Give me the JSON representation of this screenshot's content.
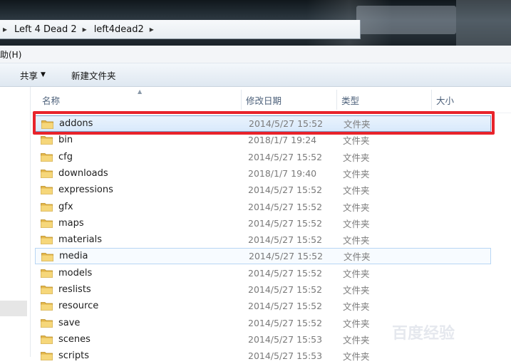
{
  "address": {
    "crumbs": [
      "Left 4 Dead 2",
      "left4dead2"
    ]
  },
  "menubar": {
    "help_label": "帮助(H)"
  },
  "toolbar": {
    "share_label": "共享",
    "new_folder_label": "新建文件夹"
  },
  "columns": {
    "name": "名称",
    "modified": "修改日期",
    "type": "类型",
    "size": "大小"
  },
  "files": [
    {
      "name": "addons",
      "modified": "2014/5/27 15:52",
      "type": "文件夹"
    },
    {
      "name": "bin",
      "modified": "2018/1/7 19:24",
      "type": "文件夹"
    },
    {
      "name": "cfg",
      "modified": "2014/5/27 15:52",
      "type": "文件夹"
    },
    {
      "name": "downloads",
      "modified": "2018/1/7 19:40",
      "type": "文件夹"
    },
    {
      "name": "expressions",
      "modified": "2014/5/27 15:52",
      "type": "文件夹"
    },
    {
      "name": "gfx",
      "modified": "2014/5/27 15:52",
      "type": "文件夹"
    },
    {
      "name": "maps",
      "modified": "2014/5/27 15:52",
      "type": "文件夹"
    },
    {
      "name": "materials",
      "modified": "2014/5/27 15:52",
      "type": "文件夹"
    },
    {
      "name": "media",
      "modified": "2014/5/27 15:52",
      "type": "文件夹"
    },
    {
      "name": "models",
      "modified": "2014/5/27 15:52",
      "type": "文件夹"
    },
    {
      "name": "reslists",
      "modified": "2014/5/27 15:52",
      "type": "文件夹"
    },
    {
      "name": "resource",
      "modified": "2014/5/27 15:52",
      "type": "文件夹"
    },
    {
      "name": "save",
      "modified": "2014/5/27 15:52",
      "type": "文件夹"
    },
    {
      "name": "scenes",
      "modified": "2014/5/27 15:53",
      "type": "文件夹"
    },
    {
      "name": "scripts",
      "modified": "2014/5/27 15:53",
      "type": "文件夹"
    }
  ],
  "selected_index": 0,
  "hover_index": 8,
  "watermark": "百度经验",
  "colors": {
    "highlight": "#e8232b",
    "selection_border": "#7da2ce",
    "header_text": "#4c607a"
  },
  "icons": {
    "folder": "folder-icon",
    "breadcrumb_separator": "chevron-right-icon",
    "dropdown": "caret-down-icon",
    "sort": "sort-up-icon"
  }
}
